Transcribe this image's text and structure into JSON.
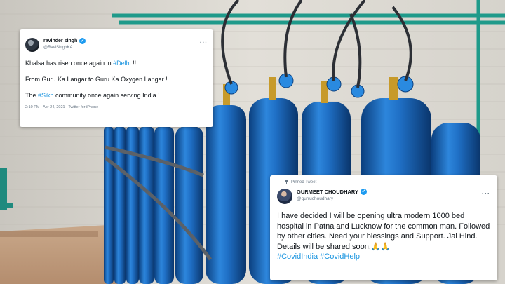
{
  "tweet1": {
    "name": "ravinder singh",
    "handle": "@RaviSinghKA",
    "more": "···",
    "line1_prefix": "Khalsa has risen once again in ",
    "line1_hashtag": "#Delhi",
    "line1_suffix": " !!",
    "line2": "From Guru Ka Langar to Guru Ka Oxygen Langar !",
    "line3_prefix": "The ",
    "line3_hashtag": "#Sikh",
    "line3_suffix": " community once again serving India !",
    "meta": "2:10 PM · Apr 24, 2021 · Twitter for iPhone"
  },
  "tweet2": {
    "pinned_label": "Pinned Tweet",
    "name": "GURMEET CHOUDHARY",
    "handle": "@gurruchoudhary",
    "more": "···",
    "body_text": "I have decided I will be opening ultra modern 1000 bed hospital in Patna and Lucknow for the common man. Followed by other cities. Need your blessings and Support. Jai Hind. Details will be shared soon.🙏🙏",
    "hashtag1": "#CovidIndia",
    "hashtag2": "#CovidHelp"
  },
  "colors": {
    "link": "#1b95e0",
    "verified": "#1d9bf0",
    "cylinder": "#1e6fc4"
  },
  "icons": [
    "verified-badge-icon",
    "more-options-icon",
    "pin-icon"
  ]
}
